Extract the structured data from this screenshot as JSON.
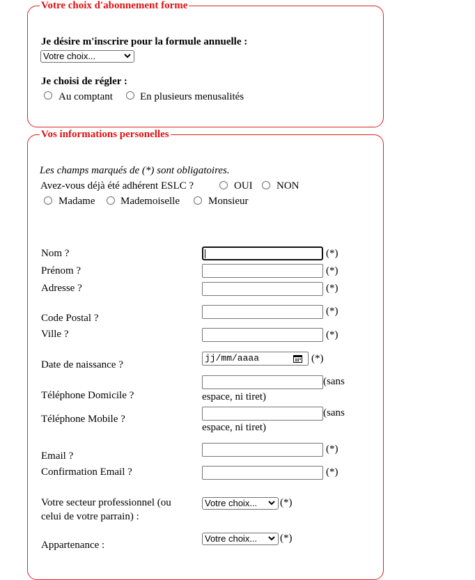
{
  "section_subscription": {
    "legend": "Votre choix d'abonnement forme",
    "formula_label": "Je désire m'inscrire pour la formule annuelle :",
    "formula_select_value": "Votre choix...",
    "payment_label": "Je choisi de régler :",
    "payment_options": [
      "Au comptant",
      "En plusieurs menusalités"
    ]
  },
  "section_personal": {
    "legend": "Vos informations personelles",
    "required_note": "Les champs marqués de (*) sont obligatoires.",
    "member_question": "Avez-vous déjà été adhérent ESLC ?",
    "member_options": [
      "OUI",
      "NON"
    ],
    "civility_options": [
      "Madame",
      "Mademoiselle",
      "Monsieur"
    ],
    "required_mark": "(*)",
    "fields": {
      "nom": "Nom ?",
      "prenom": "Prénom ?",
      "adresse": "Adresse ?",
      "code_postal": "Code Postal ?",
      "ville": "Ville ?",
      "date_naissance": "Date de naissance ?",
      "date_placeholder": "jj/mm/aaaa",
      "tel_domicile": "Téléphone Domicile ?",
      "tel_mobile": "Téléphone Mobile ?",
      "phone_hint_a": "(sans",
      "phone_hint_b": "espace, ni tiret)",
      "email": "Email ?",
      "email_confirm": "Confirmation Email ?",
      "secteur_line1": "Votre secteur professionnel (ou",
      "secteur_line2": "celui de votre parrain) :",
      "secteur_select": "Votre choix...",
      "appartenance": "Appartenance :",
      "appartenance_select": "Votre choix..."
    }
  }
}
